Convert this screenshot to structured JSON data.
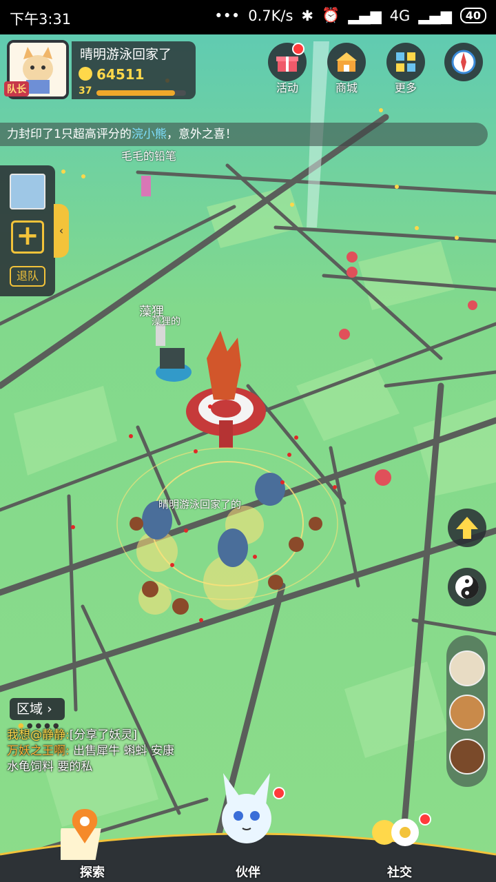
{
  "status_bar": {
    "time": "下午3:31",
    "more": "•••",
    "network_speed": "0.7K/s",
    "network_type": "4G",
    "battery": "40"
  },
  "player": {
    "name": "晴明游泳回家了",
    "coins": "64511",
    "level": "37",
    "xp_progress": 0.88,
    "badge": "队长"
  },
  "top_menu": [
    {
      "label": "活动",
      "icon": "gift-icon",
      "has_notification": true
    },
    {
      "label": "商城",
      "icon": "shop-icon",
      "has_notification": false
    },
    {
      "label": "更多",
      "icon": "grid-icon",
      "has_notification": false
    },
    {
      "label": "",
      "icon": "compass-icon",
      "has_notification": false
    }
  ],
  "ticker": {
    "prefix": "力封印了1只超高评分的",
    "highlight": "浣小熊",
    "suffix": "，意外之喜！"
  },
  "team_panel": {
    "add": "+",
    "quit_label": "退队"
  },
  "map_labels": {
    "player_far": "毛毛的铅笔",
    "other_player": "藻狸",
    "other_player_sub": "藻狸的",
    "self": "晴明游泳回家了的"
  },
  "region_button": "区域",
  "chat": [
    {
      "user": "我想@静静:",
      "text": "[分享了妖灵]"
    },
    {
      "user": "万妖之王啊:",
      "text": "出售犀牛 蝌蚪 安康"
    },
    {
      "user": "",
      "text": "水龟饲料 要的私"
    }
  ],
  "bottom_nav": [
    {
      "label": "探索"
    },
    {
      "label": "伙伴"
    },
    {
      "label": "社交"
    }
  ],
  "colors": {
    "map_bg": "#7fd68a",
    "road": "#5a5e5a",
    "accent": "#f3c33a",
    "panel": "#2d3236"
  }
}
